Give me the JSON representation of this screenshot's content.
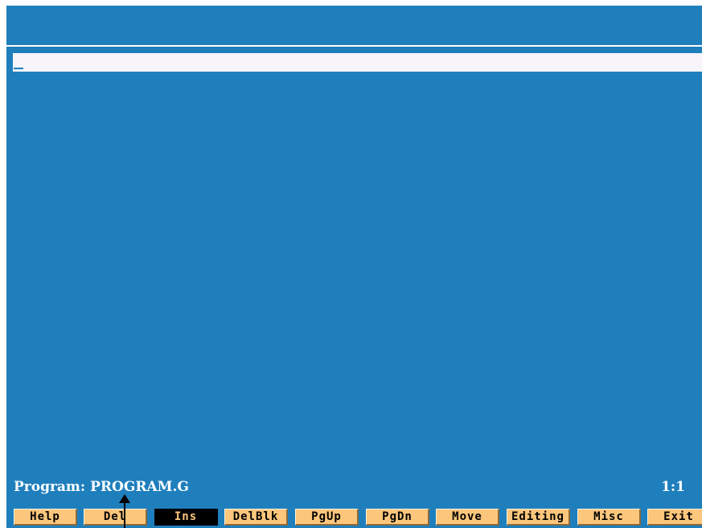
{
  "editor": {
    "current_line": ""
  },
  "status": {
    "program_label": "Program:",
    "program_name": "PROGRAM.G",
    "position": "1:1"
  },
  "fkeys": [
    {
      "label": "Help"
    },
    {
      "label": "Del"
    },
    {
      "label": "Ins",
      "active": true
    },
    {
      "label": "DelBlk"
    },
    {
      "label": "PgUp"
    },
    {
      "label": "PgDn"
    },
    {
      "label": "Move"
    },
    {
      "label": "Editing"
    },
    {
      "label": "Misc"
    },
    {
      "label": "Exit"
    }
  ],
  "colors": {
    "background": "#1f7fbd",
    "edit_line": "#f7f4fa",
    "fkey": "#fcc67c",
    "fkey_active": "#000000"
  }
}
